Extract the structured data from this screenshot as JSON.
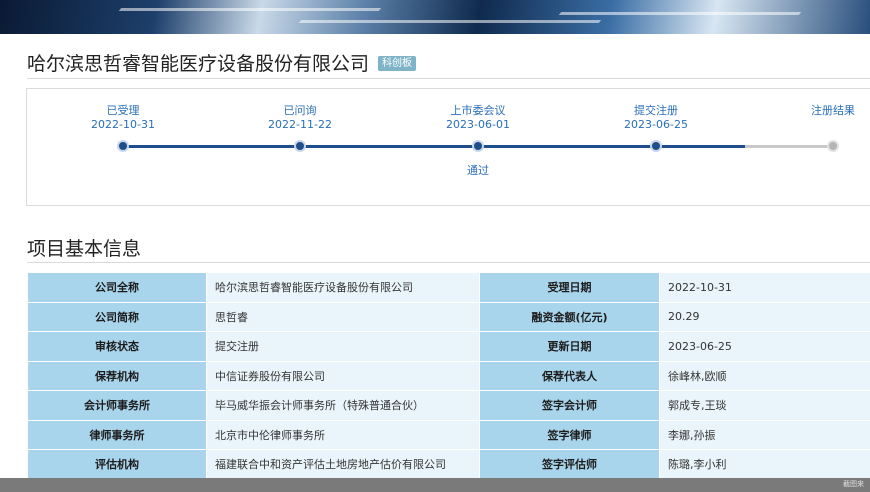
{
  "company": {
    "name": "哈尔滨思哲睿智能医疗设备股份有限公司",
    "board": "科创板"
  },
  "progress": {
    "steps": [
      {
        "label": "已受理",
        "date": "2022-10-31",
        "note": ""
      },
      {
        "label": "已问询",
        "date": "2022-11-22",
        "note": ""
      },
      {
        "label": "上市委会议",
        "date": "2023-06-01",
        "note": "通过"
      },
      {
        "label": "提交注册",
        "date": "2023-06-25",
        "note": ""
      },
      {
        "label": "注册结果",
        "date": "",
        "note": ""
      }
    ],
    "completed_steps": 4
  },
  "section": {
    "title": "项目基本信息"
  },
  "info": {
    "rows": [
      {
        "k1": "公司全称",
        "v1": "哈尔滨思哲睿智能医疗设备股份有限公司",
        "k2": "受理日期",
        "v2": "2022-10-31"
      },
      {
        "k1": "公司简称",
        "v1": "思哲睿",
        "k2": "融资金额(亿元)",
        "v2": "20.29"
      },
      {
        "k1": "审核状态",
        "v1": "提交注册",
        "k2": "更新日期",
        "v2": "2023-06-25"
      },
      {
        "k1": "保荐机构",
        "v1": "中信证券股份有限公司",
        "k2": "保荐代表人",
        "v2": "徐峰林,欧顺"
      },
      {
        "k1": "会计师事务所",
        "v1": "毕马威华振会计师事务所（特殊普通合伙）",
        "k2": "签字会计师",
        "v2": "郭成专,王琰"
      },
      {
        "k1": "律师事务所",
        "v1": "北京市中伦律师事务所",
        "k2": "签字律师",
        "v2": "李娜,孙振"
      },
      {
        "k1": "评估机构",
        "v1": "福建联合中和资产评估土地房地产估价有限公司",
        "k2": "签字评估师",
        "v2": "陈璐,李小利"
      }
    ]
  },
  "footer": {
    "watermark": "截图来"
  },
  "colors": {
    "accent": "#1f4e8c",
    "label_cell": "#a9d5ec",
    "value_cell": "#eaf5fb",
    "badge": "#7fb3c8"
  }
}
